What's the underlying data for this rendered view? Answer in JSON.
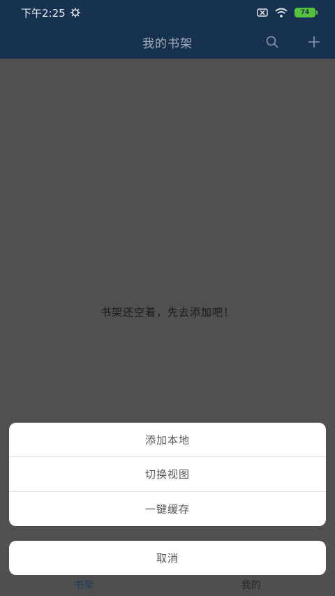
{
  "status_bar": {
    "time": "下午2:25",
    "battery": "74"
  },
  "header": {
    "title": "我的书架",
    "search_icon": "search-icon",
    "add_icon": "plus-icon"
  },
  "main": {
    "empty_message": "书架还空着，先去添加吧！"
  },
  "tabs": [
    {
      "label": "书架",
      "active": true
    },
    {
      "label": "我的",
      "active": false
    }
  ],
  "action_sheet": {
    "items": [
      "添加本地",
      "切换视图",
      "一键缓存"
    ],
    "cancel_label": "取消"
  },
  "colors": {
    "header_bg": "#173150",
    "overlay_bg": "#505050",
    "sheet_bg": "#ffffff",
    "battery": "#56c23b"
  }
}
